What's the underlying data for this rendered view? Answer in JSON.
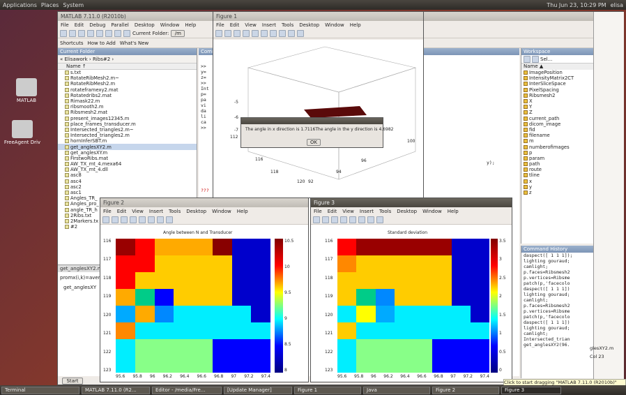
{
  "topbar": {
    "menus": [
      "Applications",
      "Places",
      "System"
    ],
    "clock": "Thu Jun 23, 10:29 PM",
    "user": "elisa"
  },
  "desktop_icons": [
    "MATLAB",
    "FreeAgent Driv"
  ],
  "matlab": {
    "title": "MATLAB 7.11.0 (R2010b)",
    "menu": [
      "File",
      "Edit",
      "Debug",
      "Parallel",
      "Desktop",
      "Window",
      "Help"
    ],
    "current_folder_label": "Current Folder:",
    "current_folder_value": "/m",
    "shortcuts": [
      "Shortcuts",
      "How to Add",
      "What's New"
    ],
    "current_folder_panel": "Current Folder",
    "path": "« Elisawork › Ribs#2 ›",
    "name_header": "Name ↑",
    "files": [
      "s.txt",
      "RotateRibMesh2.m~",
      "RotateRibMesh2.m",
      "rotateframexy2.mat",
      "Rotatedribs2.mat",
      "Rimask22.m",
      "ribsmooth2.m",
      "Ribsmesh2.mat",
      "present_images12345.m",
      "place_frames_transducer.m",
      "Intersected_triangles2.m~",
      "Intersected_triangles2.m",
      "hornInferSBT.m",
      "get_anglesXY2.m",
      "get_anglesXY.m",
      "FirstwoRibs.mat",
      "AW_TX_mt_4.mexa64",
      "AW_TX_mt_4.dll",
      "asc8",
      "asc4",
      "asc2",
      "asc1",
      "Angles_TR_",
      "Angles_pro_",
      "angle_TR_h",
      "2Ribs.txt",
      "2Markers.tx",
      "#2"
    ],
    "detail_title": "get_anglesXY2.m (M",
    "detail_line": "promx(i,k)=avera",
    "detail_fn": "get_anglesXY",
    "command_head": "Comm",
    "command_lines": [
      ">>",
      "y=",
      "z=",
      ">>",
      "Int",
      "p=",
      "pa",
      "vi",
      "da",
      "li",
      "ca",
      ">>"
    ],
    "command_tail": "y);",
    "command_q": "???",
    "workspace_title": "Workspace",
    "workspace_select": "Sel...",
    "workspace_name": "Name ▲",
    "vars": [
      "ImagePosition",
      "IntensityMatrix2CT",
      "InterSliceSpace",
      "PixelSpacing",
      "Ribsmesh2",
      "X",
      "Y",
      "Z",
      "current_path",
      "dicom_image",
      "fid",
      "filename",
      "m",
      "numberofimages",
      "p",
      "param",
      "path",
      "route",
      "tline",
      "x",
      "y",
      "z"
    ],
    "cmd_history_title": "Command History",
    "cmd_history": [
      "daspect([ 1 1 1]);",
      "lighting gouraud;",
      "camlight;",
      "p.faces=Ribsmesh2",
      "p.vertices=Ribsme",
      "patch(p,'facecolo",
      "daspect([ 1 1 1])",
      "lighting gouraud;",
      "camlight;",
      "p.faces=Ribsmesh2",
      "p.vertices=Ribsme",
      "patch(p,'facecolo",
      "daspect([ 1 1 1])",
      "lighting gouraud;",
      "camlight;",
      "Intersected_trian",
      "get_anglesXY2(96."
    ],
    "start": "Start",
    "tooltip": "Click to start dragging \"MATLAB 7.11.0 (R2010b)\"",
    "status_file": "glesXY2.m",
    "status_col": "Col 23"
  },
  "figure1": {
    "title": "Figure 1",
    "menu": [
      "File",
      "Edit",
      "View",
      "Insert",
      "Tools",
      "Desktop",
      "Window",
      "Help"
    ],
    "z_ticks": [
      "-5",
      "-6",
      "-7"
    ],
    "axis_labels": [
      "112",
      "114",
      "116",
      "118",
      "120",
      "92",
      "94",
      "96",
      "98",
      "100"
    ],
    "dialog_message": "The angle in x direction is 1.7116The angle in the y direction is 4.6982",
    "ok": "OK"
  },
  "figure2": {
    "title": "Figure 2",
    "menu": [
      "File",
      "Edit",
      "View",
      "Insert",
      "Tools",
      "Desktop",
      "Window",
      "Help"
    ],
    "plot_title": "Angle between N and Transducer",
    "y_ticks": [
      "116",
      "117",
      "118",
      "119",
      "120",
      "121",
      "122",
      "123"
    ],
    "x_ticks": [
      "95.6",
      "95.8",
      "96",
      "96.2",
      "96.4",
      "96.6",
      "96.8",
      "97",
      "97.2",
      "97.4"
    ],
    "cbar_ticks": [
      "10.5",
      "10",
      "9.5",
      "9",
      "8.5",
      "8"
    ]
  },
  "figure3": {
    "title": "Figure 3",
    "menu": [
      "File",
      "Edit",
      "View",
      "Insert",
      "Tools",
      "Desktop",
      "Window",
      "Help"
    ],
    "plot_title": "Standard deviation",
    "y_ticks": [
      "116",
      "117",
      "118",
      "119",
      "120",
      "121",
      "122",
      "123"
    ],
    "x_ticks": [
      "95.6",
      "95.8",
      "96",
      "96.2",
      "96.4",
      "96.6",
      "96.8",
      "97",
      "97.2",
      "97.4"
    ],
    "cbar_ticks": [
      "3.5",
      "3",
      "2.5",
      "2",
      "1.5",
      "1",
      "0.5",
      "0"
    ]
  },
  "taskbar": [
    "Terminal",
    "MATLAB 7.11.0 (R2...",
    "Editor - /media/Fre...",
    "[Update Manager]",
    "Figure 1",
    "Java",
    "Figure 2",
    "Figure 3"
  ]
}
